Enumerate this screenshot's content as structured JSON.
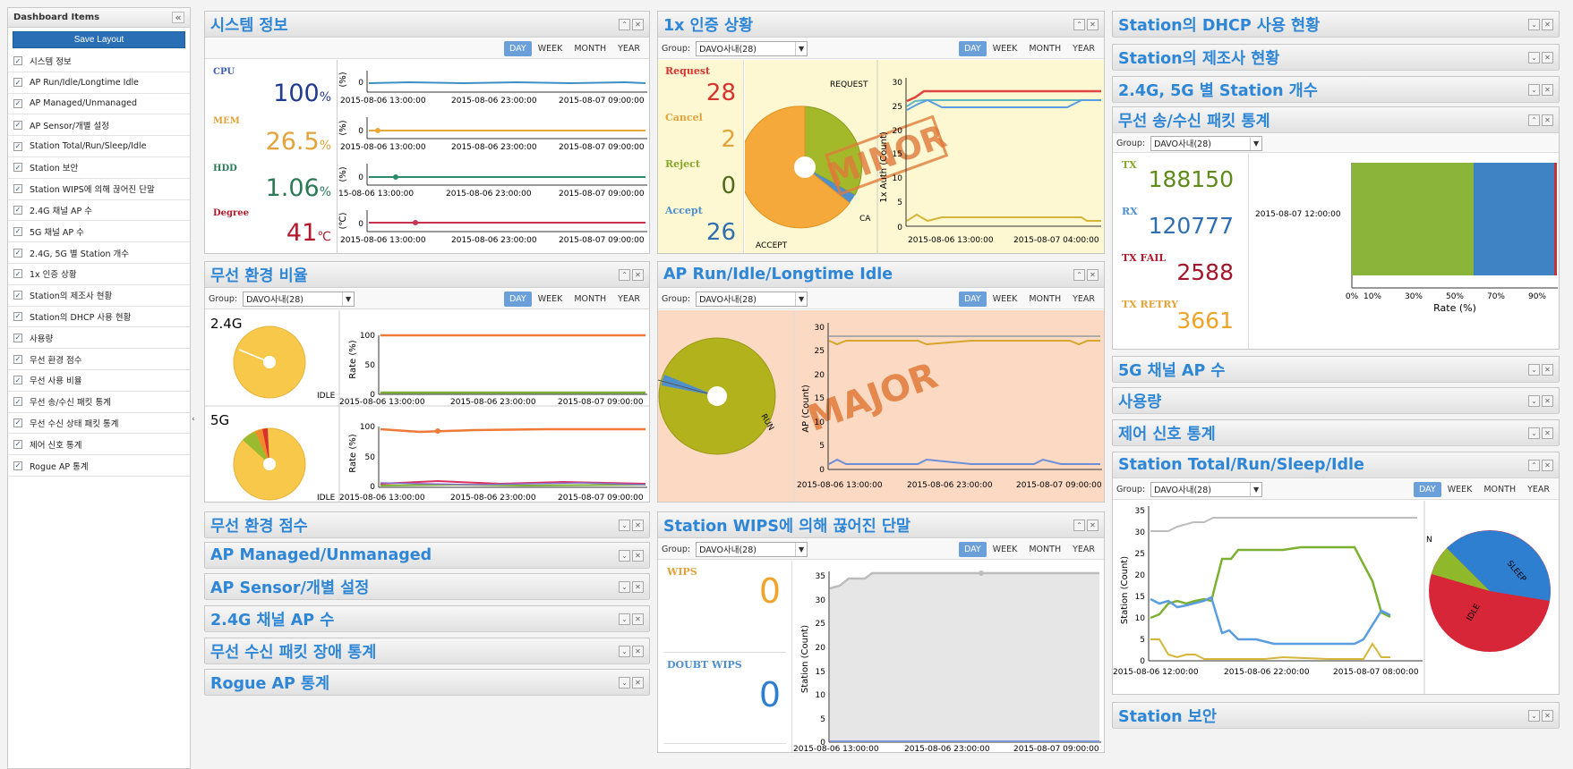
{
  "sidebar": {
    "title": "Dashboard Items",
    "collapse_icon": "«",
    "save_label": "Save Layout",
    "items": [
      "시스템 정보",
      "AP Run/Idle/Longtime Idle",
      "AP Managed/Unmanaged",
      "AP Sensor/개별 설정",
      "Station Total/Run/Sleep/Idle",
      "Station 보안",
      "Station WIPS에 의해 끊어진 단말",
      "2.4G 채널 AP 수",
      "5G 채널 AP 수",
      "2.4G, 5G 별 Station 개수",
      "1x 인증 상황",
      "Station의 제조사 현황",
      "Station의 DHCP 사용 현황",
      "사용량",
      "무선 환경 점수",
      "무선 사용 비율",
      "무선 송/수신 패킷 통계",
      "무선 수신 상태 패킷 통계",
      "제어 신호 통계",
      "Rogue AP 통계"
    ],
    "edge_arrow": "‹"
  },
  "common": {
    "group_label": "Group:",
    "group_value": "DAVO사내(28)",
    "period": [
      "DAY",
      "WEEK",
      "MONTH",
      "YEAR"
    ]
  },
  "sysinfo": {
    "title": "시스템 정보",
    "cpu_label": "CPU",
    "cpu_value": "100",
    "cpu_unit": "%",
    "mem_label": "MEM",
    "mem_value": "26.5",
    "mem_unit": "%",
    "hdd_label": "HDD",
    "hdd_value": "1.06",
    "hdd_unit": "%",
    "deg_label": "Degree",
    "deg_value": "41",
    "deg_unit": "℃",
    "times_a": [
      "2015-08-06 13:00:00",
      "2015-08-06 23:00:00",
      "2015-08-07 09:00:00"
    ],
    "times_b": [
      "15-08-06 13:00:00",
      "2015-08-06 23:00:00",
      "2015-08-07 09:00:00"
    ],
    "unit_pct": "(%)",
    "unit_deg": "(℃)",
    "y0": "0"
  },
  "auth": {
    "title": "1x 인증 상황",
    "request_label": "Request",
    "request_value": "28",
    "cancel_label": "Cancel",
    "cancel_value": "2",
    "reject_label": "Reject",
    "reject_value": "0",
    "accept_label": "Accept",
    "accept_value": "26",
    "pie_request": "REQUEST",
    "pie_accept": "ACCEPT",
    "pie_ca": "CA",
    "stamp": "MINOR",
    "ylabel": "1x Auth (Count)",
    "yticks": [
      "30",
      "25",
      "20",
      "15",
      "10",
      "5",
      "0"
    ],
    "times": [
      "2015-08-06 13:00:00",
      "2015-08-07 04:00:00"
    ]
  },
  "dhcp": {
    "title": "Station의 DHCP 사용 현황"
  },
  "maker": {
    "title": "Station의 제조사 현황"
  },
  "bandcount": {
    "title": "2.4G, 5G 별 Station 개수"
  },
  "packet": {
    "title": "무선 송/수신 패킷 통계",
    "tx_label": "TX",
    "tx_value": "188150",
    "rx_label": "RX",
    "rx_value": "120777",
    "txfail_label": "TX FAIL",
    "txfail_value": "2588",
    "txretry_label": "TX RETRY",
    "txretry_value": "3661",
    "bar_time": "2015-08-07 12:00:00",
    "xticks": [
      "0%",
      "10%",
      "30%",
      "50%",
      "70%",
      "90%"
    ],
    "xlabel": "Rate (%)"
  },
  "envrate": {
    "title": "무선 환경 비율",
    "band24": "2.4G",
    "band5": "5G",
    "idle_label": "IDLE",
    "idle_label2": "IDLE",
    "ylabel": "Rate (%)",
    "yticks": [
      "100",
      "50",
      "0"
    ],
    "times": [
      "2015-08-06 13:00:00",
      "2015-08-06 23:00:00",
      "2015-08-07 09:00:00"
    ]
  },
  "aprun": {
    "title": "AP Run/Idle/Longtime Idle",
    "run_label": "RUN",
    "stamp": "MAJOR",
    "ylabel": "AP (Count)",
    "yticks": [
      "30",
      "25",
      "20",
      "15",
      "10",
      "5",
      "0"
    ],
    "times": [
      "2015-08-06 13:00:00",
      "2015-08-06 23:00:00",
      "2015-08-07 09:00:00"
    ]
  },
  "ch5g": {
    "title": "5G 채널 AP 수"
  },
  "usage": {
    "title": "사용량"
  },
  "ctrl": {
    "title": "제어 신호 통계"
  },
  "sta": {
    "title": "Station Total/Run/Sleep/Idle",
    "ylabel": "Station (Count)",
    "yticks": [
      "35",
      "30",
      "25",
      "20",
      "15",
      "10",
      "5",
      "0"
    ],
    "times": [
      "2015-08-06 12:00:00",
      "2015-08-06 22:00:00",
      "2015-08-07 08:00:00"
    ],
    "pie_sleep": "SLEEP",
    "pie_idle": "IDLE",
    "pie_n": "N"
  },
  "envscore": {
    "title": "무선 환경 점수"
  },
  "apman": {
    "title": "AP Managed/Unmanaged"
  },
  "apsensor": {
    "title": "AP Sensor/개별 설정"
  },
  "ch24": {
    "title": "2.4G 채널 AP 수"
  },
  "rxerr": {
    "title": "무선 수신 패킷 장애 통계"
  },
  "rogue": {
    "title": "Rogue AP 통계"
  },
  "wips": {
    "title": "Station WIPS에 의해 끊어진 단말",
    "wips_label": "WIPS",
    "wips_value": "0",
    "doubt_label": "DOUBT WIPS",
    "doubt_value": "0",
    "ylabel": "Station (Count)",
    "yticks": [
      "35",
      "30",
      "25",
      "20",
      "15",
      "10",
      "5",
      "0"
    ],
    "times": [
      "2015-08-06 13:00:00",
      "2015-08-06 23:00:00",
      "2015-08-07 09:00:00"
    ]
  },
  "stasec": {
    "title": "Station 보안"
  },
  "colors": {
    "accent": "#2e86d6",
    "cpu": "#1f3a8f",
    "mem": "#e2a33a",
    "hdd": "#2a7a55",
    "deg": "#b3192b",
    "request": "#d8322e",
    "cancel": "#e2a33a",
    "reject": "#87a82c",
    "accept": "#4f8fcc",
    "stamp": "#e07a3a"
  },
  "icons": {
    "panel_buttons": [
      "collapse-icon",
      "close-icon"
    ]
  }
}
